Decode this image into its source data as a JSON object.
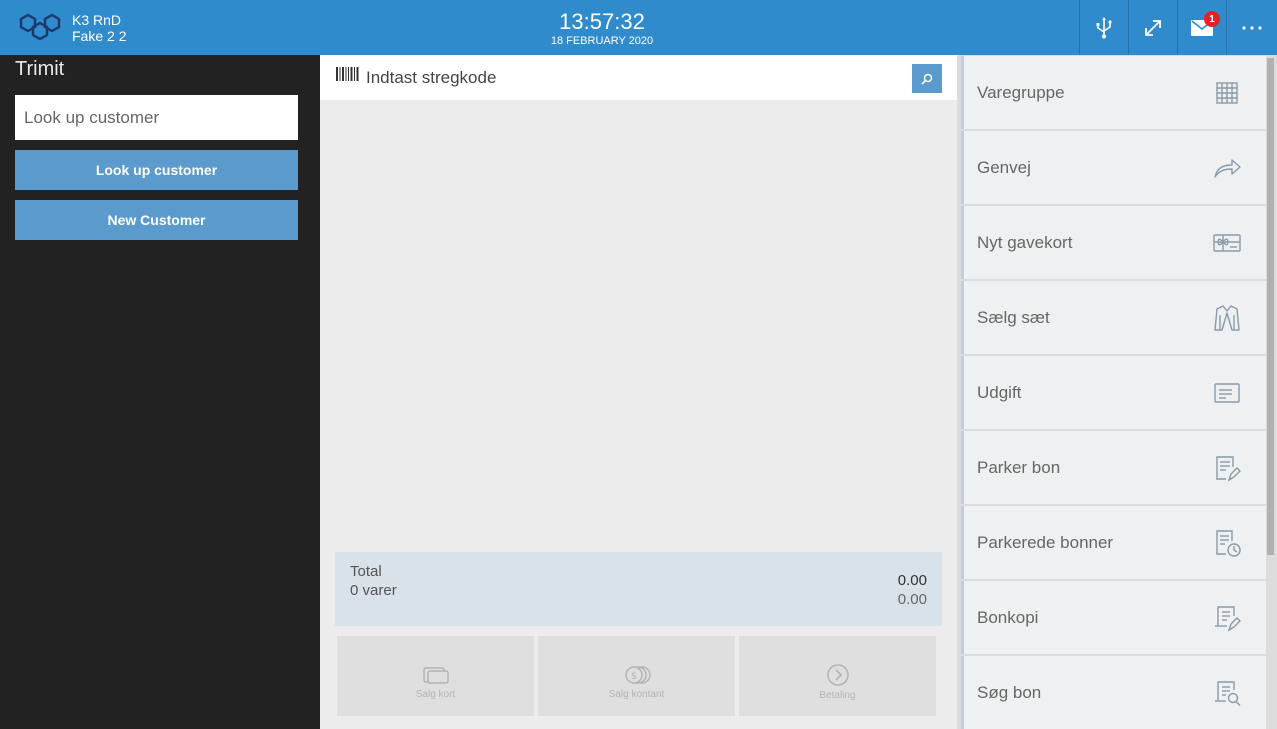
{
  "topbar": {
    "company": "K3 RnD",
    "store": "Fake 2  2",
    "time": "13:57:32",
    "date": "18 FEBRUARY 2020",
    "mail_badge": "1",
    "colors": {
      "bar": "#2f8bcc",
      "badge": "#e02424"
    }
  },
  "left": {
    "title": "Trimit",
    "search_placeholder": "Look up customer",
    "lookup_button": "Look up customer",
    "new_button": "New Customer"
  },
  "center": {
    "barcode_placeholder": "Indtast stregkode",
    "total_label": "Total",
    "items_label": "0 varer",
    "total_value": "0.00",
    "total_sub": "0.00",
    "pay_buttons": [
      {
        "label": "Salg kort",
        "icon": "card-icon"
      },
      {
        "label": "Salg kontant",
        "icon": "cash-icon"
      },
      {
        "label": "Betaling",
        "icon": "arrow-right-circle-icon"
      }
    ]
  },
  "right": {
    "items": [
      {
        "label": "Varegruppe",
        "icon": "grid-icon"
      },
      {
        "label": "Genvej",
        "icon": "share-arrow-icon"
      },
      {
        "label": "Nyt gavekort",
        "icon": "gift-card-icon"
      },
      {
        "label": "Sælg sæt",
        "icon": "jacket-icon"
      },
      {
        "label": "Udgift",
        "icon": "receipt-list-icon"
      },
      {
        "label": "Parker bon",
        "icon": "park-receipt-icon"
      },
      {
        "label": "Parkerede bonner",
        "icon": "parked-receipts-clock-icon"
      },
      {
        "label": "Bonkopi",
        "icon": "receipt-copy-icon"
      },
      {
        "label": "Søg bon",
        "icon": "search-receipt-icon"
      }
    ]
  }
}
